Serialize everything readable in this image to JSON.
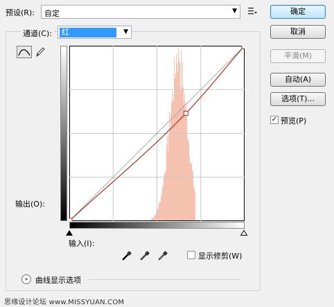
{
  "preset": {
    "label": "预设(R):",
    "value": "自定",
    "menu_icon": "list-menu-icon"
  },
  "buttons": {
    "ok": "确定",
    "cancel": "取消",
    "smooth": "平滑(M)",
    "auto": "自动(A)",
    "options": "选项(T)..."
  },
  "preview": {
    "label": "预览(P)",
    "checked": true,
    "check_glyph": "✓"
  },
  "channel": {
    "label": "通道(C):",
    "value": "红"
  },
  "curve": {
    "output_label": "输出(O):",
    "input_label": "输入(I):",
    "grid_divisions": 4,
    "curve_color": "#a8302a",
    "histogram_color": "#f5c2b0",
    "control_points": [
      [
        0,
        0
      ],
      [
        170,
        157
      ],
      [
        255,
        255
      ]
    ]
  },
  "show_clipping": {
    "label": "显示修剪(W)",
    "checked": false
  },
  "curve_display_options": {
    "label": "曲线显示选项"
  },
  "watermark": "思缘设计论坛  www.MISSYUAN.COM"
}
